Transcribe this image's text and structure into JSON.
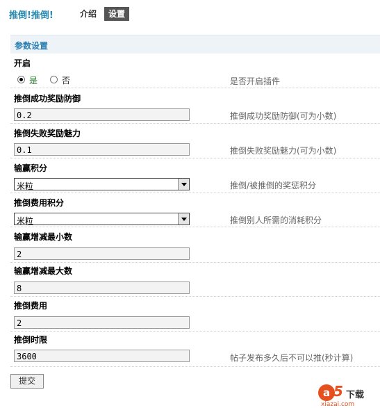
{
  "header": {
    "title": "推倒!推倒!",
    "tabs": [
      "介绍",
      "设置"
    ]
  },
  "section_title": "参数设置",
  "fields": [
    {
      "label": "开启",
      "type": "radio",
      "options": [
        "是",
        "否"
      ],
      "selected": "是",
      "description": "是否开启插件"
    },
    {
      "label": "推倒成功奖励防御",
      "type": "text",
      "value": "0.2",
      "description": "推倒成功奖励防御(可为小数)"
    },
    {
      "label": "推倒失败奖励魅力",
      "type": "text",
      "value": "0.1",
      "description": "推倒失败奖励魅力(可为小数)"
    },
    {
      "label": "输赢积分",
      "type": "select",
      "value": "米粒",
      "description": "推倒/被推倒的奖惩积分"
    },
    {
      "label": "推倒费用积分",
      "type": "select",
      "value": "米粒",
      "description": "推倒别人所需的消耗积分"
    },
    {
      "label": "输赢增减最小数",
      "type": "text",
      "value": "2",
      "description": ""
    },
    {
      "label": "输赢增减最大数",
      "type": "text",
      "value": "8",
      "description": ""
    },
    {
      "label": "推倒费用",
      "type": "text",
      "value": "2",
      "description": ""
    },
    {
      "label": "推倒时限",
      "type": "text",
      "value": "3600",
      "description": "帖子发布多久后不可以推(秒计算)"
    }
  ],
  "submit_label": "提交",
  "watermark": {
    "mark": "a",
    "digit": "5",
    "text": "下载",
    "url": "xiazai.com"
  }
}
